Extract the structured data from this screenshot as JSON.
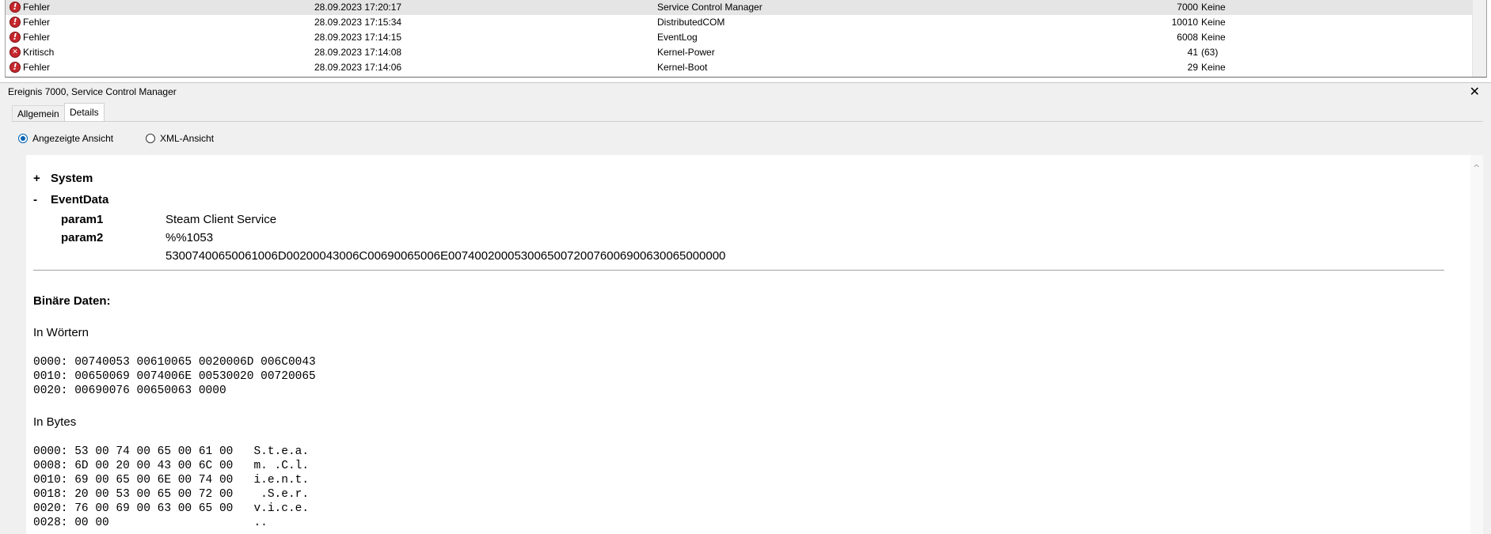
{
  "event_list": {
    "rows": [
      {
        "level_icon": "error-icon",
        "level": "Fehler",
        "date": "28.09.2023 17:20:17",
        "source": "Service Control Manager",
        "event_id": "7000",
        "task": "Keine",
        "selected": true
      },
      {
        "level_icon": "error-icon",
        "level": "Fehler",
        "date": "28.09.2023 17:15:34",
        "source": "DistributedCOM",
        "event_id": "10010",
        "task": "Keine",
        "selected": false
      },
      {
        "level_icon": "error-icon",
        "level": "Fehler",
        "date": "28.09.2023 17:14:15",
        "source": "EventLog",
        "event_id": "6008",
        "task": "Keine",
        "selected": false
      },
      {
        "level_icon": "critical-icon",
        "level": "Kritisch",
        "date": "28.09.2023 17:14:08",
        "source": "Kernel-Power",
        "event_id": "41",
        "task": "(63)",
        "selected": false
      },
      {
        "level_icon": "error-icon",
        "level": "Fehler",
        "date": "28.09.2023 17:14:06",
        "source": "Kernel-Boot",
        "event_id": "29",
        "task": "Keine",
        "selected": false
      }
    ]
  },
  "details": {
    "title": "Ereignis 7000, Service Control Manager",
    "close_icon": "close-icon",
    "tabs": [
      {
        "label": "Allgemein",
        "active": false
      },
      {
        "label": "Details",
        "active": true
      }
    ],
    "views": [
      {
        "label": "Angezeigte Ansicht",
        "checked": true
      },
      {
        "label": "XML-Ansicht",
        "checked": false
      }
    ],
    "system": {
      "sign": "+",
      "label": "System"
    },
    "eventdata": {
      "sign": "-",
      "label": "EventData"
    },
    "params": [
      {
        "key": "param1",
        "value": "Steam Client Service"
      },
      {
        "key": "param2",
        "value": "%%1053"
      }
    ],
    "param2_extra": "53007400650061006D00200043006C00690065006E007400200053006500720076006900630065000000",
    "binary_heading": "Binäre Daten:",
    "words_heading": "In Wörtern",
    "words_lines": [
      "0000: 00740053 00610065 0020006D 006C0043",
      "0010: 00650069 0074006E 00530020 00720065",
      "0020: 00690076 00650063 0000"
    ],
    "bytes_heading": "In Bytes",
    "bytes_lines": [
      "0000: 53 00 74 00 65 00 61 00   S.t.e.a.",
      "0008: 6D 00 20 00 43 00 6C 00   m. .C.l.",
      "0010: 69 00 65 00 6E 00 74 00   i.e.n.t.",
      "0018: 20 00 53 00 65 00 72 00    .S.e.r.",
      "0020: 76 00 69 00 63 00 65 00   v.i.c.e.",
      "0028: 00 00                     .."
    ]
  },
  "colors": {
    "accent": "#0063b1",
    "error": "#c6282d",
    "selected_row": "#e5e5e5"
  }
}
